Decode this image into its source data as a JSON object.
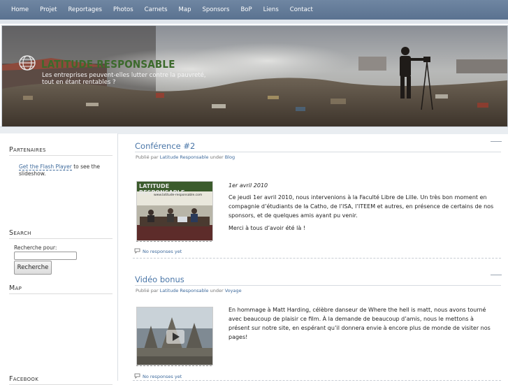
{
  "nav": {
    "items": [
      "Home",
      "Projet",
      "Reportages",
      "Photos",
      "Carnets",
      "Map",
      "Sponsors",
      "BoP",
      "Liens",
      "Contact"
    ]
  },
  "banner": {
    "title": "LATITUDE RESPONSABLE",
    "subtitle": "Les entreprises peuvent-elles lutter contre la pauvreté, tout en étant rentables ?",
    "logo_icon": "globe-icon"
  },
  "sidebar": {
    "partenaires": {
      "heading": "Partenaires",
      "link": "Get the Flash Player",
      "text": " to see the slideshow."
    },
    "search": {
      "heading": "Search",
      "label": "Recherche pour:",
      "value": "",
      "button": "Recherche"
    },
    "map": {
      "heading": "Map"
    },
    "facebook": {
      "heading": "Facebook"
    }
  },
  "posts": [
    {
      "title": "Conférence #2",
      "meta_prefix": "Publié par ",
      "author": "Latitude Responsable",
      "meta_mid": " under ",
      "category": "Blog",
      "date": "1er avril 2010",
      "body1": "Ce jeudi 1er avril 2010, nous intervenions à la Faculté Libre de Lille. Un très bon moment en compagnie d’étudiants de la Catho, de l’ISA, l’ITEEM et autres, en présence de certains de nos sponsors, et de quelques amis ayant pu venir.",
      "body2": "Merci à tous d’avoir été là !",
      "thumb_banner": "LATITUDE RESPONSABLE",
      "thumb_url": "www.latitude-responsable.com",
      "comments": "No responses yet"
    },
    {
      "title": "Vidéo bonus",
      "meta_prefix": "Publié par ",
      "author": "Latitude Responsable",
      "meta_mid": " under ",
      "category": "Voyage",
      "body1": "En hommage à Matt Harding, célèbre danseur de Where the hell is matt, nous avons tourné avec beaucoup de plaisir ce film. À la demande de beaucoup d’amis, nous le mettons à présent sur notre site, en espérant qu’il donnera envie à encore plus de monde de visiter nos pages!",
      "comments": "No responses yet"
    }
  ],
  "colors": {
    "nav_bg": "#637b98",
    "link": "#3e6a9c",
    "title_green": "#3c6a2c"
  }
}
